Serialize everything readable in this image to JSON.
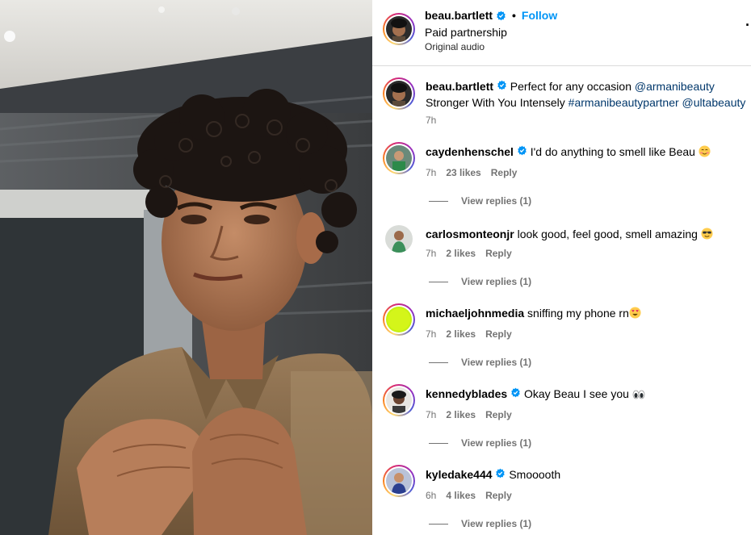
{
  "post": {
    "username": "beau.bartlett",
    "separator": "•",
    "follow_label": "Follow",
    "subtitle": "Paid partnership",
    "audio": "Original audio",
    "more_icon": "more-options-icon"
  },
  "caption": {
    "username": "beau.bartlett",
    "text_before": "Perfect for any occasion ",
    "mention1": "@armanibeauty",
    "text_mid": "Stronger With You Intensely ",
    "hashtag": "#armanibeautypartner",
    "mention2": "@ultabeauty",
    "time": "7h"
  },
  "comments": [
    {
      "username": "caydenhenschel",
      "verified": true,
      "text": "I'd do anything to smell like Beau",
      "emoji": "blushing-face-icon",
      "time": "7h",
      "likes": "23 likes",
      "reply": "Reply",
      "view_replies": "View replies (1)"
    },
    {
      "username": "carlosmonteonjr",
      "verified": false,
      "text": "look good, feel good, smell amazing",
      "emoji": "sunglasses-face-icon",
      "time": "7h",
      "likes": "2 likes",
      "reply": "Reply",
      "view_replies": "View replies (1)"
    },
    {
      "username": "michaeljohnmedia",
      "verified": false,
      "text": "sniffing my phone rn",
      "emoji": "heart-eyes-face-icon",
      "time": "7h",
      "likes": "2 likes",
      "reply": "Reply",
      "view_replies": "View replies (1)"
    },
    {
      "username": "kennedyblades",
      "verified": true,
      "text": "Okay Beau I see you",
      "emoji": "eyes-icon",
      "time": "7h",
      "likes": "2 likes",
      "reply": "Reply",
      "view_replies": "View replies (1)"
    },
    {
      "username": "kyledake444",
      "verified": true,
      "text": "Smooooth",
      "emoji": "",
      "time": "6h",
      "likes": "4 likes",
      "reply": "Reply",
      "view_replies": "View replies (1)"
    }
  ],
  "colors": {
    "follow": "#0095f6",
    "link": "#00376b",
    "meta": "#737373",
    "verified": "#0095f6"
  }
}
